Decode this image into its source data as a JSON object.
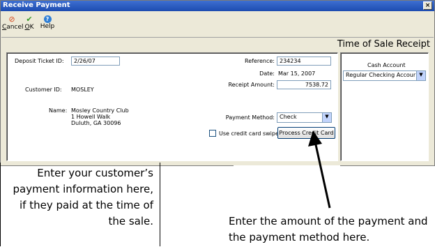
{
  "window": {
    "title": "Receive Payment",
    "close_glyph": "×"
  },
  "toolbar": {
    "cancel": {
      "label_ul": "C",
      "label_rest": "ancel",
      "icon": "cancel-icon",
      "glyph": "⊘",
      "color": "#d64a1f"
    },
    "ok": {
      "label_ul": "O",
      "label_rest": "K",
      "icon": "checkmark-icon",
      "glyph": "✔",
      "color": "#3a9a2a"
    },
    "help": {
      "label": "Help",
      "icon": "help-icon",
      "glyph": "?",
      "color": "#2f7fd6"
    }
  },
  "receipt_title": "Time of Sale Receipt",
  "form": {
    "deposit_ticket_label": "Deposit Ticket ID:",
    "deposit_ticket_value": "2/26/07",
    "customer_id_label": "Customer ID:",
    "customer_id_value": "MOSLEY",
    "name_label": "Name:",
    "name_line1": "Mosley Country Club",
    "name_line2": "1 Howell Walk",
    "name_line3": "Duluth, GA 30096",
    "reference_label": "Reference:",
    "reference_value": "234234",
    "date_label": "Date:",
    "date_value": "Mar 15, 2007",
    "receipt_amount_label": "Receipt Amount:",
    "receipt_amount_value": "7538.72",
    "payment_method_label": "Payment Method:",
    "payment_method_value": "Check",
    "credit_swipe_label": "Use credit card swipe",
    "process_card_button": "Process Credit Card"
  },
  "cash_account": {
    "label": "Cash Account",
    "value": "Regular Checking Accour"
  },
  "callouts": {
    "left": "Enter your customer’s payment information here, if they paid at the time of the sale.",
    "right": "Enter the amount of the payment and the payment method here."
  }
}
